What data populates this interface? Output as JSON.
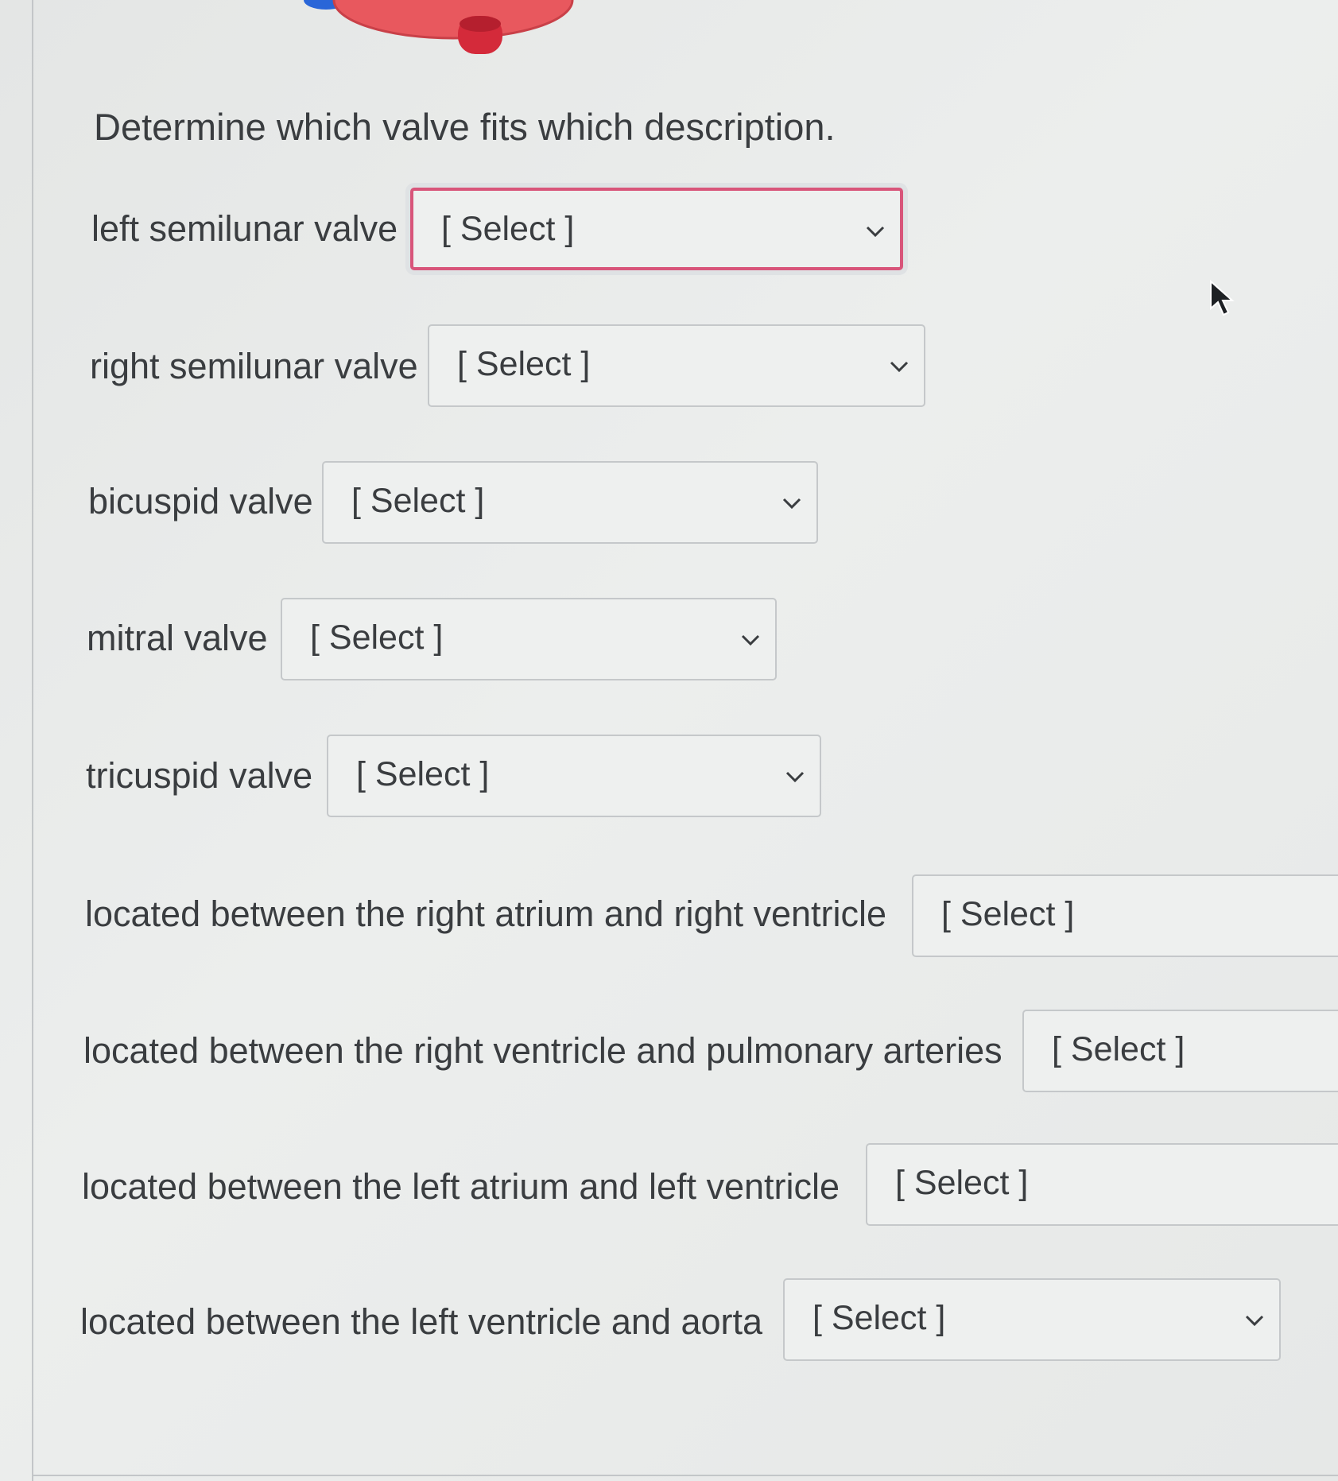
{
  "prompt": "Determine which valve fits which description.",
  "questions": [
    {
      "label": "left semilunar valve",
      "value": "[ Select ]"
    },
    {
      "label": "right semilunar valve",
      "value": "[ Select ]"
    },
    {
      "label": "bicuspid valve",
      "value": "[ Select ]"
    },
    {
      "label": "mitral valve",
      "value": "[ Select ]"
    },
    {
      "label": "tricuspid valve",
      "value": "[ Select ]"
    },
    {
      "label": "located between the right atrium and right ventricle",
      "value": "[ Select ]"
    },
    {
      "label": "located between the right ventricle and pulmonary arteries",
      "value": "[ Select ]"
    },
    {
      "label": "located between the left atrium and left ventricle",
      "value": "[ Select ]"
    },
    {
      "label": "located between the left ventricle and aorta",
      "value": "[ Select ]"
    }
  ],
  "colors": {
    "focus_border": "#d8557a",
    "heart": "#e8585e",
    "vessel": "#d42a3a",
    "vessel_blue": "#2a66d8"
  }
}
